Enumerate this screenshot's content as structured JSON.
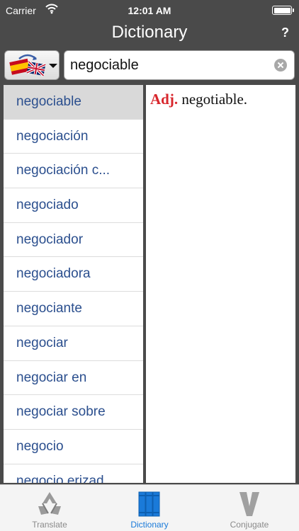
{
  "status_bar": {
    "carrier": "Carrier",
    "time": "12:01 AM"
  },
  "navbar": {
    "title": "Dictionary",
    "help_label": "?"
  },
  "search": {
    "value": "negociable"
  },
  "word_list": [
    "negociable",
    "negociación",
    "negociación c...",
    "negociado",
    "negociador",
    "negociadora",
    "negociante",
    "negociar",
    "negociar en",
    "negociar sobre",
    "negocio",
    "negocio erizad"
  ],
  "selected_index": 0,
  "definition": {
    "pos": "Adj.",
    "text": " negotiable."
  },
  "tabs": [
    {
      "label": "Translate",
      "icon": "recycle-icon"
    },
    {
      "label": "Dictionary",
      "icon": "books-icon"
    },
    {
      "label": "Conjugate",
      "icon": "v-letter-icon"
    }
  ],
  "active_tab": 1,
  "colors": {
    "accent": "#1a7ad9",
    "word": "#2b4f8e",
    "pos": "#d8262c",
    "chrome": "#4a4a4a"
  }
}
